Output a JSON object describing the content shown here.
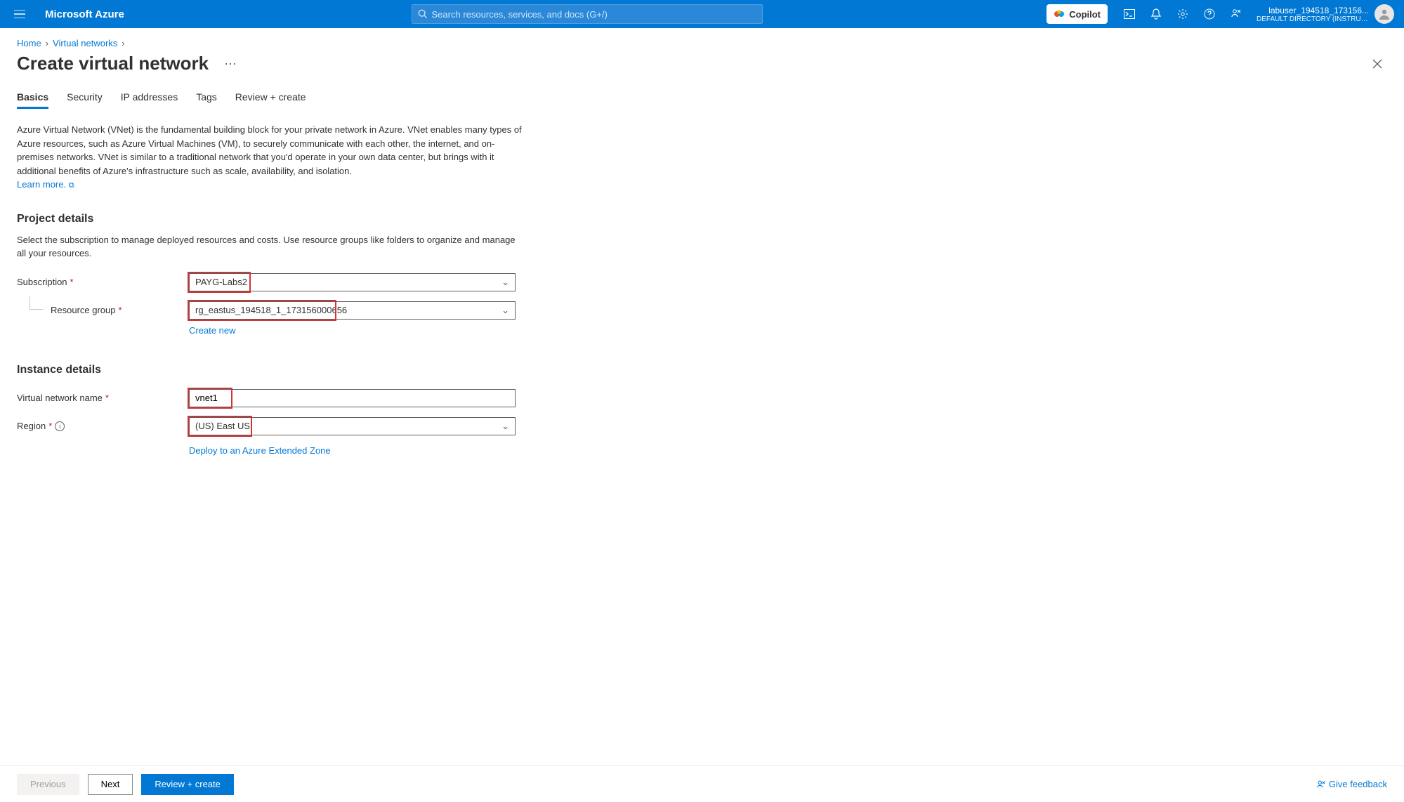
{
  "topbar": {
    "brand": "Microsoft Azure",
    "search_placeholder": "Search resources, services, and docs (G+/)",
    "copilot_label": "Copilot",
    "user_name": "labuser_194518_173156...",
    "tenant": "DEFAULT DIRECTORY (INSTRUCT..."
  },
  "breadcrumb": {
    "home": "Home",
    "l2": "Virtual networks"
  },
  "page": {
    "title": "Create virtual network",
    "more": "···"
  },
  "tabs": {
    "t0": "Basics",
    "t1": "Security",
    "t2": "IP addresses",
    "t3": "Tags",
    "t4": "Review + create"
  },
  "intro": {
    "text": "Azure Virtual Network (VNet) is the fundamental building block for your private network in Azure. VNet enables many types of Azure resources, such as Azure Virtual Machines (VM), to securely communicate with each other, the internet, and on-premises networks. VNet is similar to a traditional network that you'd operate in your own data center, but brings with it additional benefits of Azure's infrastructure such as scale, availability, and isolation.",
    "learn_more": "Learn more."
  },
  "project": {
    "heading": "Project details",
    "sub": "Select the subscription to manage deployed resources and costs. Use resource groups like folders to organize and manage all your resources.",
    "subscription_label": "Subscription",
    "subscription_value": "PAYG-Labs2",
    "rg_label": "Resource group",
    "rg_value": "rg_eastus_194518_1_173156000656",
    "create_new": "Create new"
  },
  "instance": {
    "heading": "Instance details",
    "name_label": "Virtual network name",
    "name_value": "vnet1",
    "region_label": "Region",
    "region_value": "(US) East US",
    "extended_link": "Deploy to an Azure Extended Zone"
  },
  "footer": {
    "prev": "Previous",
    "next": "Next",
    "review": "Review + create",
    "feedback": "Give feedback"
  }
}
